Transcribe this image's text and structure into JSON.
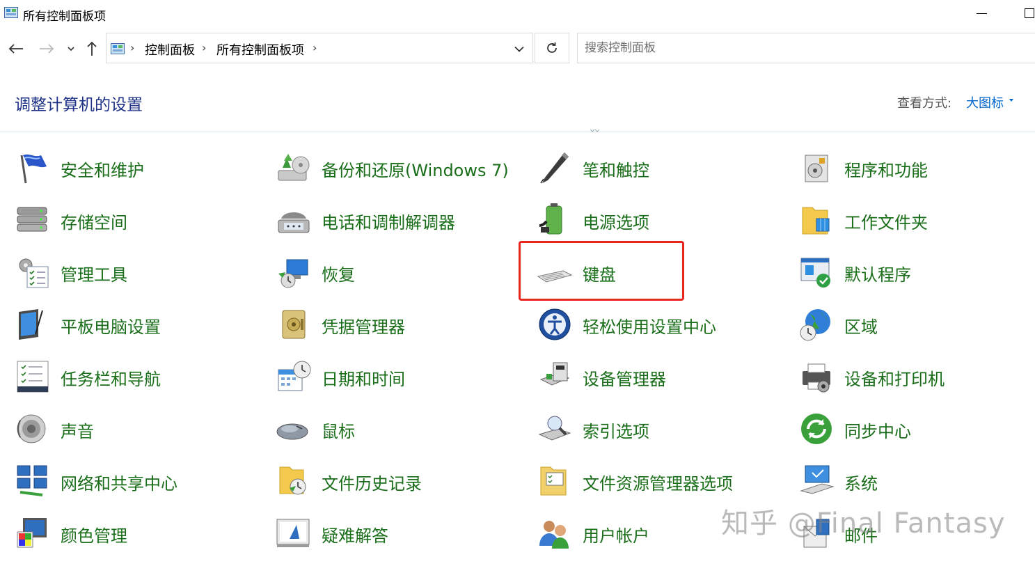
{
  "window": {
    "title": "所有控制面板项"
  },
  "address": {
    "crumbs": [
      "控制面板",
      "所有控制面板项"
    ],
    "search_placeholder": "搜索控制面板"
  },
  "header": {
    "title": "调整计算机的设置",
    "view_label": "查看方式:",
    "view_value": "大图标"
  },
  "items": [
    {
      "label": "安全和维护",
      "icon": "security-flag-icon"
    },
    {
      "label": "备份和还原(Windows 7)",
      "icon": "backup-restore-icon"
    },
    {
      "label": "笔和触控",
      "icon": "pen-icon"
    },
    {
      "label": "程序和功能",
      "icon": "programs-icon"
    },
    {
      "label": "存储空间",
      "icon": "storage-icon"
    },
    {
      "label": "电话和调制解调器",
      "icon": "phone-modem-icon"
    },
    {
      "label": "电源选项",
      "icon": "power-battery-icon"
    },
    {
      "label": "工作文件夹",
      "icon": "work-folders-icon"
    },
    {
      "label": "管理工具",
      "icon": "admin-tools-icon"
    },
    {
      "label": "恢复",
      "icon": "recovery-icon"
    },
    {
      "label": "键盘",
      "icon": "keyboard-icon"
    },
    {
      "label": "默认程序",
      "icon": "default-programs-icon"
    },
    {
      "label": "平板电脑设置",
      "icon": "tablet-icon"
    },
    {
      "label": "凭据管理器",
      "icon": "credential-vault-icon"
    },
    {
      "label": "轻松使用设置中心",
      "icon": "ease-of-access-icon"
    },
    {
      "label": "区域",
      "icon": "region-globe-icon"
    },
    {
      "label": "任务栏和导航",
      "icon": "taskbar-icon"
    },
    {
      "label": "日期和时间",
      "icon": "date-time-icon"
    },
    {
      "label": "设备管理器",
      "icon": "device-manager-icon"
    },
    {
      "label": "设备和打印机",
      "icon": "printer-icon"
    },
    {
      "label": "声音",
      "icon": "speaker-icon"
    },
    {
      "label": "鼠标",
      "icon": "mouse-icon"
    },
    {
      "label": "索引选项",
      "icon": "indexing-icon"
    },
    {
      "label": "同步中心",
      "icon": "sync-icon"
    },
    {
      "label": "网络和共享中心",
      "icon": "network-icon"
    },
    {
      "label": "文件历史记录",
      "icon": "file-history-icon"
    },
    {
      "label": "文件资源管理器选项",
      "icon": "folder-options-icon"
    },
    {
      "label": "系统",
      "icon": "system-monitor-icon"
    },
    {
      "label": "颜色管理",
      "icon": "color-management-icon"
    },
    {
      "label": "疑难解答",
      "icon": "troubleshooting-icon"
    },
    {
      "label": "用户帐户",
      "icon": "user-accounts-icon"
    },
    {
      "label": "邮件",
      "icon": "mail-icon"
    }
  ],
  "watermark": "知乎 @Final Fantasy",
  "colors": {
    "item_text": "#1a6e1a",
    "title_text": "#1e3287",
    "link": "#0066cc",
    "highlight": "#e8261f"
  }
}
